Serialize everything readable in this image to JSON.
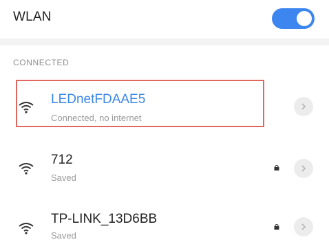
{
  "header": {
    "title": "WLAN",
    "wlan_enabled": true,
    "accent_color": "#3d86f0"
  },
  "section": {
    "label": "CONNECTED"
  },
  "networks": [
    {
      "name": "LEDnetFDAAE5",
      "status": "Connected, no internet",
      "secured": false,
      "highlighted": true,
      "icon": "wifi-icon"
    },
    {
      "name": "712",
      "status": "Saved",
      "secured": true,
      "icon": "wifi-icon"
    },
    {
      "name": "TP-LINK_13D6BB",
      "status": "Saved",
      "secured": true,
      "icon": "wifi-icon"
    }
  ],
  "colors": {
    "connected_text": "#3a86ea",
    "highlight_border": "#e0675f"
  }
}
